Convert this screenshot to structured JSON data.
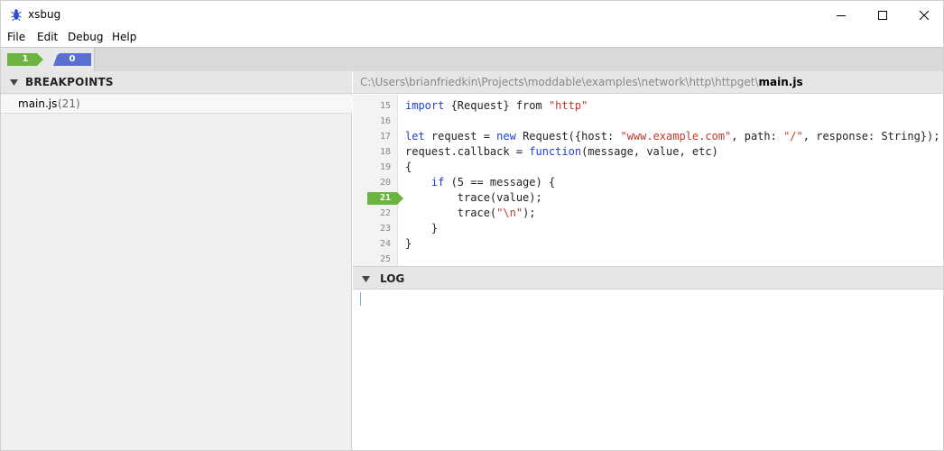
{
  "window": {
    "title": "xsbug"
  },
  "menu": [
    "File",
    "Edit",
    "Debug",
    "Help"
  ],
  "tabs": [
    {
      "count": "1",
      "color": "#6cb33f"
    },
    {
      "count": "0",
      "color": "#5a6fd1"
    }
  ],
  "breakpoints": {
    "title": "BREAKPOINTS",
    "items": [
      {
        "file": "main.js",
        "line": "(21)"
      }
    ]
  },
  "editor": {
    "path_dir": "C:\\Users\\brianfriedkin\\Projects\\moddable\\examples\\network\\http\\httpget\\",
    "path_file": "main.js",
    "active_line": "21",
    "lines": [
      {
        "num": "15",
        "parts": [
          {
            "t": "import",
            "c": "kw"
          },
          {
            "t": " {Request} from "
          },
          {
            "t": "\"http\"",
            "c": "str"
          }
        ]
      },
      {
        "num": "16",
        "parts": []
      },
      {
        "num": "17",
        "parts": [
          {
            "t": "let",
            "c": "kw"
          },
          {
            "t": " request = "
          },
          {
            "t": "new",
            "c": "kw"
          },
          {
            "t": " Request({host: "
          },
          {
            "t": "\"www.example.com\"",
            "c": "str"
          },
          {
            "t": ", path: "
          },
          {
            "t": "\"/\"",
            "c": "str"
          },
          {
            "t": ", response: String});"
          }
        ]
      },
      {
        "num": "18",
        "parts": [
          {
            "t": "request.callback = "
          },
          {
            "t": "function",
            "c": "kw"
          },
          {
            "t": "(message, value, etc)"
          }
        ]
      },
      {
        "num": "19",
        "parts": [
          {
            "t": "{"
          }
        ]
      },
      {
        "num": "20",
        "parts": [
          {
            "t": "    "
          },
          {
            "t": "if",
            "c": "kw"
          },
          {
            "t": " (5 == message) {"
          }
        ]
      },
      {
        "num": "21",
        "parts": [
          {
            "t": "        trace(value);"
          }
        ]
      },
      {
        "num": "22",
        "parts": [
          {
            "t": "        trace("
          },
          {
            "t": "\"\\n\"",
            "c": "str"
          },
          {
            "t": ");"
          }
        ]
      },
      {
        "num": "23",
        "parts": [
          {
            "t": "    }"
          }
        ]
      },
      {
        "num": "24",
        "parts": [
          {
            "t": "}"
          }
        ]
      },
      {
        "num": "25",
        "parts": []
      }
    ],
    "keyword_color": "#1f3fd0",
    "string_color": "#c0392b",
    "breakpoint_color": "#6cb33f"
  },
  "log": {
    "title": "LOG"
  }
}
